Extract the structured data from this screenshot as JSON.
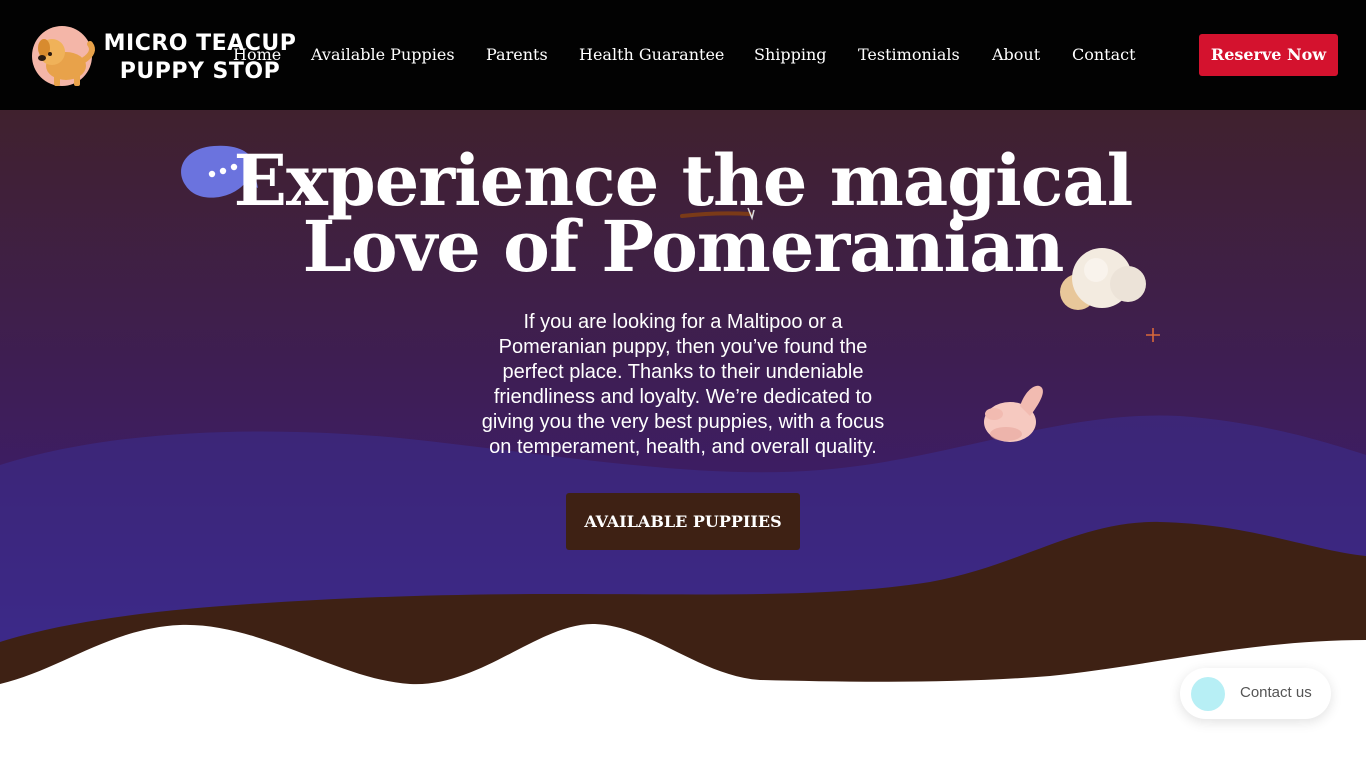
{
  "header": {
    "logo": {
      "line1": "MICRO TEACUP",
      "line2": "PUPPY STOP"
    },
    "nav": [
      {
        "label": "Home"
      },
      {
        "label": "Available Puppies"
      },
      {
        "label": "Parents"
      },
      {
        "label": "Health Guarantee"
      },
      {
        "label": "Shipping"
      },
      {
        "label": "Testimonials"
      },
      {
        "label": "About"
      },
      {
        "label": "Contact"
      }
    ],
    "cta_label": "Reserve Now"
  },
  "hero": {
    "title_line1": "Experience the magical",
    "title_line2": "Love of Pomeranian",
    "description": "If you are looking for a Maltipoo or a Pomeranian puppy, then you’ve found the perfect place. Thanks to their undeniable friendliness and loyalty. We’re dedicated to giving you the very best puppies, with a focus on temperament, health, and overall quality.",
    "button_label": "AVAILABLE PUPPIIES"
  },
  "contact_widget": {
    "label": "Contact us"
  },
  "colors": {
    "header_bg": "#020202",
    "reserve_button": "#d4122e",
    "hero_top": "#40212e",
    "hero_bottom": "#3c2a8c",
    "brown_wave": "#3e2114",
    "cta_button": "#3e2114"
  },
  "icons": {
    "logo_mascot": "dog-icon",
    "chat_bubble": "chat-bubble-icon",
    "cloud_balls": "cloud-balls-icon",
    "sparkle": "sparkle-icon",
    "hand": "thumbs-gesture-icon"
  }
}
